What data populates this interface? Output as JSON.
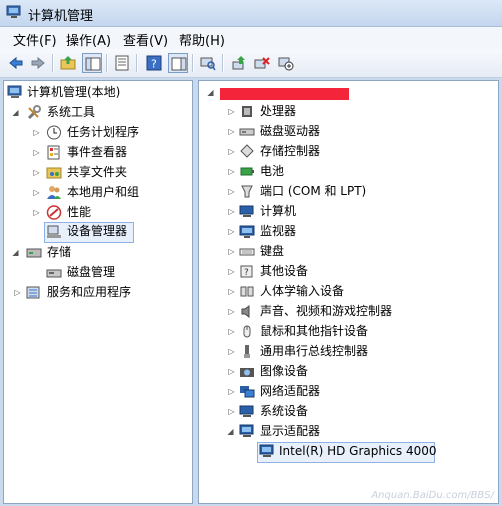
{
  "window": {
    "title": "计算机管理"
  },
  "menu": {
    "file": "文件(F)",
    "action": "操作(A)",
    "view": "查看(V)",
    "help": "帮助(H)"
  },
  "left_tree": {
    "root": "计算机管理(本地)",
    "system_tools": "系统工具",
    "task_scheduler": "任务计划程序",
    "event_viewer": "事件查看器",
    "shared_folders": "共享文件夹",
    "local_users": "本地用户和组",
    "performance": "性能",
    "device_manager": "设备管理器",
    "storage": "存储",
    "disk_management": "磁盘管理",
    "services": "服务和应用程序"
  },
  "device_tree": {
    "categories": [
      {
        "label": "处理器",
        "icon": "cpu-icon"
      },
      {
        "label": "磁盘驱动器",
        "icon": "disk-drive-icon"
      },
      {
        "label": "存储控制器",
        "icon": "storage-controller-icon"
      },
      {
        "label": "电池",
        "icon": "battery-icon"
      },
      {
        "label": "端口 (COM 和 LPT)",
        "icon": "port-icon"
      },
      {
        "label": "计算机",
        "icon": "computer-icon"
      },
      {
        "label": "监视器",
        "icon": "monitor-icon"
      },
      {
        "label": "键盘",
        "icon": "keyboard-icon"
      },
      {
        "label": "其他设备",
        "icon": "other-devices-icon"
      },
      {
        "label": "人体学输入设备",
        "icon": "hid-icon"
      },
      {
        "label": "声音、视频和游戏控制器",
        "icon": "sound-icon"
      },
      {
        "label": "鼠标和其他指针设备",
        "icon": "mouse-icon"
      },
      {
        "label": "通用串行总线控制器",
        "icon": "usb-icon"
      },
      {
        "label": "图像设备",
        "icon": "imaging-icon"
      },
      {
        "label": "网络适配器",
        "icon": "network-icon"
      },
      {
        "label": "系统设备",
        "icon": "system-devices-icon"
      },
      {
        "label": "显示适配器",
        "icon": "display-adapter-icon"
      }
    ],
    "display_child": "Intel(R) HD Graphics 4000"
  },
  "watermark": "Anquan.BaiDu.com/BBS/",
  "colors": {
    "redaction": "#f4253a",
    "selection_border": "#8fb2e4",
    "selection_fill": "#e8f0fc"
  }
}
